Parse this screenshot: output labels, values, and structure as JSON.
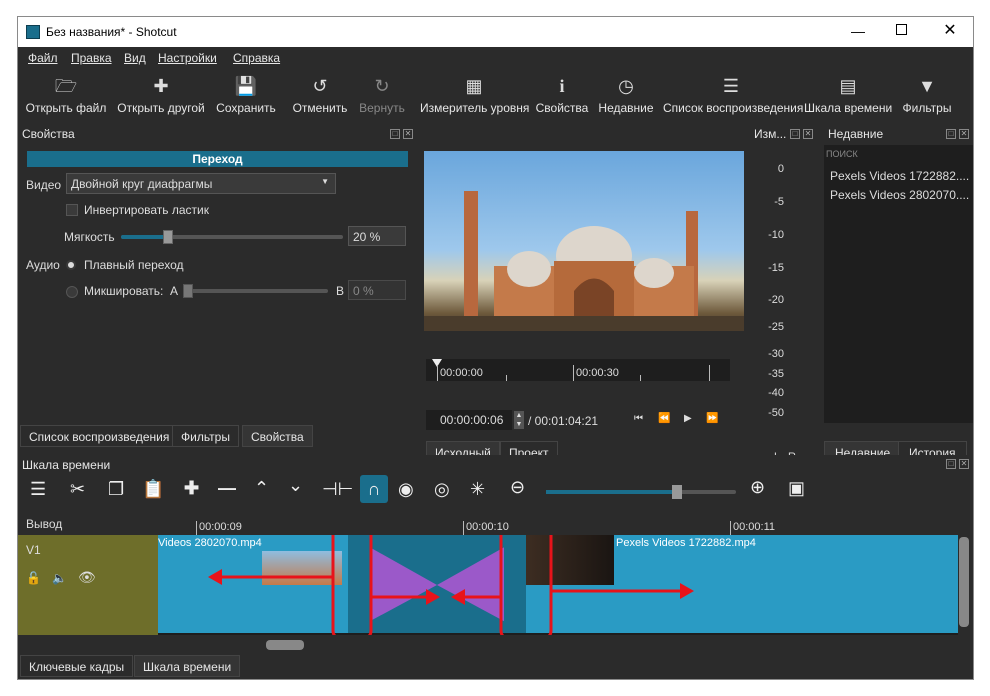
{
  "window": {
    "title": "Без названия* - Shotcut"
  },
  "menu": [
    "Файл",
    "Правка",
    "Вид",
    "Настройки",
    "Справка"
  ],
  "toolbar": [
    {
      "label": "Открыть файл",
      "icon": "folder-open-icon"
    },
    {
      "label": "Открыть другой",
      "icon": "open-other-icon"
    },
    {
      "label": "Сохранить",
      "icon": "save-icon"
    },
    {
      "label": "Отменить",
      "icon": "undo-icon"
    },
    {
      "label": "Вернуть",
      "icon": "redo-icon"
    },
    {
      "label": "Измеритель уровня",
      "icon": "audio-meter-icon"
    },
    {
      "label": "Свойства",
      "icon": "info-icon"
    },
    {
      "label": "Недавние",
      "icon": "clock-icon"
    },
    {
      "label": "Список воспроизведения",
      "icon": "list-icon"
    },
    {
      "label": "Шкала времени",
      "icon": "timeline-icon"
    },
    {
      "label": "Фильтры",
      "icon": "funnel-icon"
    }
  ],
  "properties": {
    "title": "Свойства",
    "header": "Переход",
    "video_label": "Видео",
    "video_value": "Двойной круг диафрагмы",
    "invert_label": "Инвертировать ластик",
    "softness_label": "Мягкость",
    "softness_value": "20 %",
    "softness_level": 0.2,
    "audio_label": "Аудио",
    "crossfade_label": "Плавный переход",
    "mix_label": "Микшировать:",
    "mix_a": "A",
    "mix_b": "B",
    "mix_value": "0 %",
    "tabs": [
      "Список воспроизведения",
      "Фильтры",
      "Свойства"
    ]
  },
  "player": {
    "ruler_labels": [
      "00:00:00",
      "00:00:30"
    ],
    "current_time": "00:00:00:06",
    "total_time": "/ 00:01:04:21",
    "tabs": [
      "Исходный",
      "Проект"
    ]
  },
  "meter": {
    "title": "Изм...",
    "scale": [
      "0",
      "-5",
      "-10",
      "-15",
      "-20",
      "-25",
      "-30",
      "-35",
      "-40",
      "-50"
    ],
    "channels": [
      "L",
      "R"
    ]
  },
  "recent": {
    "title": "Недавние",
    "search_placeholder": "поиск",
    "items": [
      "Pexels Videos 1722882....",
      "Pexels Videos 2802070...."
    ],
    "tabs": [
      "Недавние",
      "История"
    ]
  },
  "timeline": {
    "title": "Шкала времени",
    "output_label": "Вывод",
    "track_label": "V1",
    "ruler_labels": [
      "00:00:09",
      "00:00:10",
      "00:00:11"
    ],
    "clip1_name": "Videos 2802070.mp4",
    "clip2_name": "Pexels Videos 1722882.mp4",
    "bottom_tabs": [
      "Ключевые кадры",
      "Шкала времени"
    ]
  },
  "colors": {
    "accent": "#1a6e8c",
    "clip": "#2a9bc4",
    "transition": "#9b59c9",
    "annotation": "#e8131a",
    "track_head": "#6e6e2a"
  }
}
